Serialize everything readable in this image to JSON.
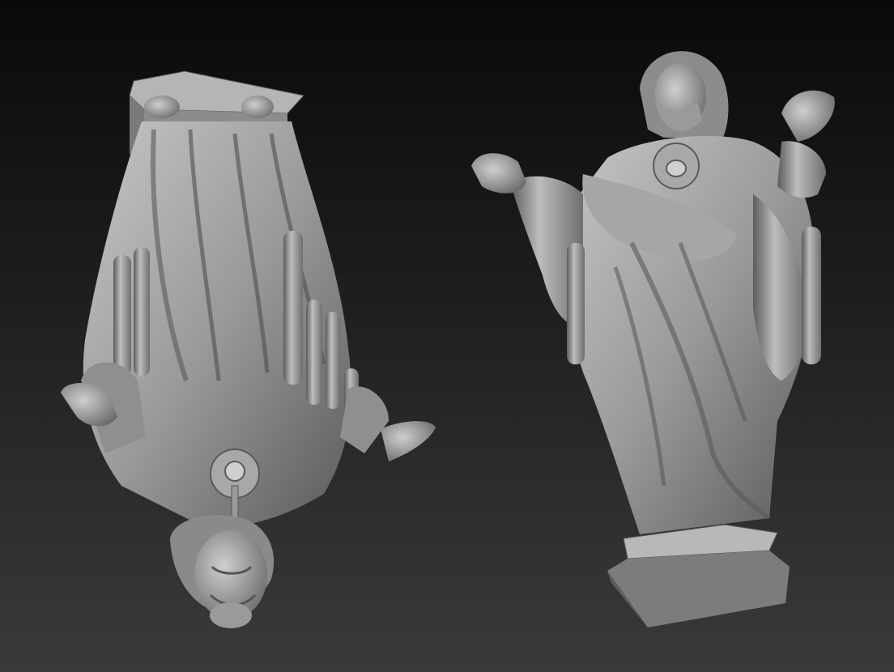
{
  "scene": {
    "background_top": "#0a0a0a",
    "background_bottom": "#3a3a3a",
    "material_color": "#9a9a9a",
    "material_highlight": "#c8c8c8",
    "material_shadow": "#3c3c3c"
  },
  "models": [
    {
      "name": "statue-inverted",
      "orientation": "upside-down"
    },
    {
      "name": "statue-upright",
      "orientation": "upright"
    }
  ]
}
